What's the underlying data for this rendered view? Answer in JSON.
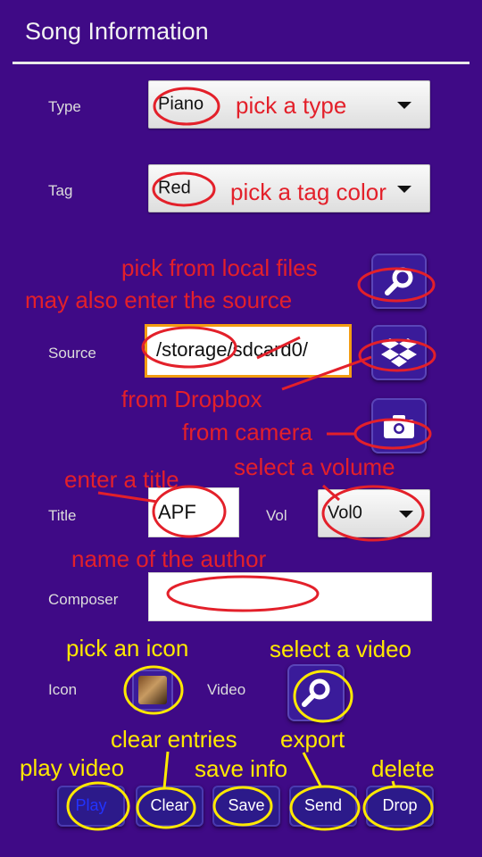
{
  "header": {
    "title": "Song Information"
  },
  "form": {
    "type_label": "Type",
    "type_value": "Piano",
    "tag_label": "Tag",
    "tag_value": "Red",
    "source_label": "Source",
    "source_value": "/storage/sdcard0/",
    "title_label": "Title",
    "title_value": "APF",
    "vol_label": "Vol",
    "vol_value": "Vol0",
    "composer_label": "Composer",
    "composer_value": "",
    "icon_label": "Icon",
    "video_label": "Video"
  },
  "buttons": {
    "play": "Play",
    "clear": "Clear",
    "save": "Save",
    "send": "Send",
    "drop": "Drop"
  },
  "annotations": {
    "pick_type": "pick a type",
    "pick_tag": "pick a tag color",
    "pick_local": "pick from local files",
    "enter_source": "may also enter the source",
    "from_dropbox": "from Dropbox",
    "from_camera": "from camera",
    "enter_title": "enter a title",
    "select_volume": "select a volume",
    "author_name": "name of the author",
    "pick_icon": "pick an icon",
    "select_video": "select a video",
    "clear_entries": "clear entries",
    "export": "export",
    "play_video": "play video",
    "save_info": "save info",
    "delete": "delete"
  },
  "colors": {
    "background": "#3f0a86",
    "annotation_red": "#e3202a",
    "annotation_yellow": "#ffe800",
    "source_focus": "#f39c12"
  }
}
